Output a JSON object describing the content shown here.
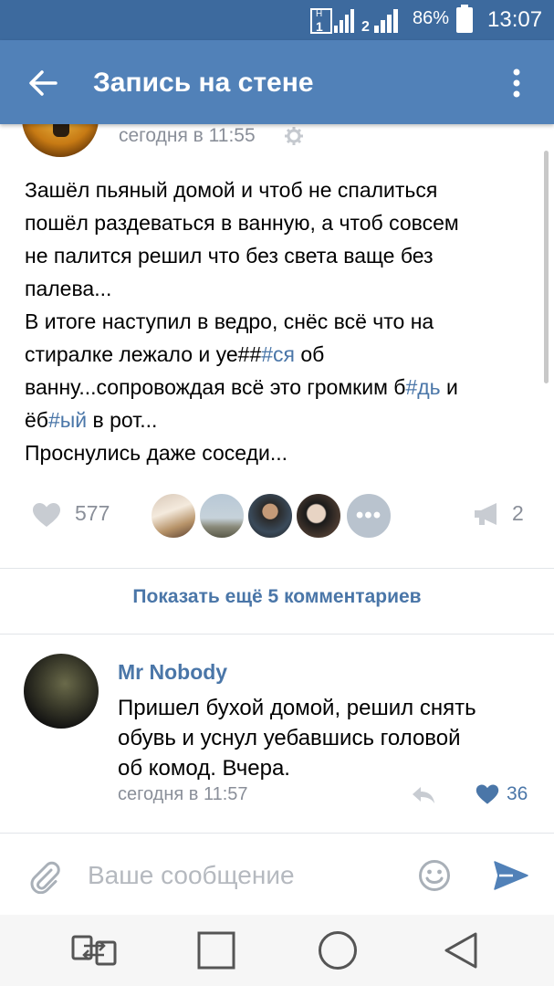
{
  "status_bar": {
    "sim1_label": "1",
    "sim1_net": "H",
    "sim2_label": "2",
    "battery_percent": "86%",
    "time": "13:07"
  },
  "app_bar": {
    "title": "Запись на стене"
  },
  "post": {
    "timestamp": "сегодня в 11:55",
    "lines": [
      [
        {
          "t": "Зашёл пьяный домой и чтоб не спалиться"
        }
      ],
      [
        {
          "t": "пошёл раздеваться в ванную, а чтоб совсем"
        }
      ],
      [
        {
          "t": "не палится решил что без света ваще без"
        }
      ],
      [
        {
          "t": "палева..."
        }
      ],
      [
        {
          "t": "В итоге наступил в ведро, снёс всё что на"
        }
      ],
      [
        {
          "t": "стиралке лежало и уе##"
        },
        {
          "t": "#ся",
          "tag": true
        },
        {
          "t": " об"
        }
      ],
      [
        {
          "t": "ванну...сопровождая всё это громким б"
        },
        {
          "t": "#дь",
          "tag": true
        },
        {
          "t": " и"
        }
      ],
      [
        {
          "t": "ёб"
        },
        {
          "t": "#ый",
          "tag": true
        },
        {
          "t": " в рот..."
        }
      ],
      [
        {
          "t": "Проснулись даже соседи..."
        }
      ]
    ],
    "likes_count": "577",
    "more_likers_label": "•••",
    "shares_count": "2"
  },
  "show_more_comments": "Показать ещё 5 комментариев",
  "comment": {
    "author": "Mr Nobody",
    "lines": [
      "Пришел бухой домой, решил снять",
      "обувь и уснул уебавшись головой",
      "об комод. Вчера."
    ],
    "timestamp": "сегодня в 11:57",
    "likes_count": "36"
  },
  "composer": {
    "placeholder": "Ваше сообщение"
  },
  "colors": {
    "status_bar": "#3d6a9e",
    "app_bar": "#5181b8",
    "link": "#4a76a8",
    "muted": "#8a8f99"
  },
  "icons": {
    "back": "arrow-left-icon",
    "menu": "more-vertical-icon",
    "settings": "gear-icon",
    "like": "heart-icon",
    "share": "megaphone-icon",
    "reply": "reply-icon",
    "attach": "paperclip-icon",
    "emoji": "smile-icon",
    "send": "send-icon"
  }
}
